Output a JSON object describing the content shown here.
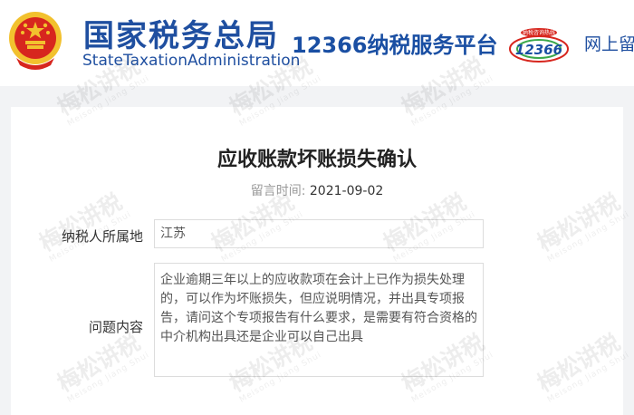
{
  "header": {
    "agency_cn": "国家税务总局",
    "agency_en": "StateTaxationAdministration",
    "platform": "12366纳税服务平台",
    "logo_small_text": "纳税咨询热线",
    "logo_number": "12366",
    "nav_partial": "网上留"
  },
  "page": {
    "title": "应收账款坏账损失确认",
    "date_label": "留言时间:",
    "date_value": "2021-09-02"
  },
  "form": {
    "region_label": "纳税人所属地",
    "region_value": "江苏",
    "question_label": "问题内容",
    "question_value": "企业逾期三年以上的应收款项在会计上已作为损失处理的，可以作为坏账损失，但应说明情况，并出具专项报告，请问这个专项报告有什么要求，是需要有符合资格的中介机构出具还是企业可以自己出具"
  },
  "watermark": {
    "text": "梅松讲税",
    "sub": "Meisong Jiang Shui"
  },
  "colors": {
    "brand_blue": "#1f4fa0",
    "emblem_red": "#d7261e",
    "emblem_gold": "#f2c12e"
  }
}
